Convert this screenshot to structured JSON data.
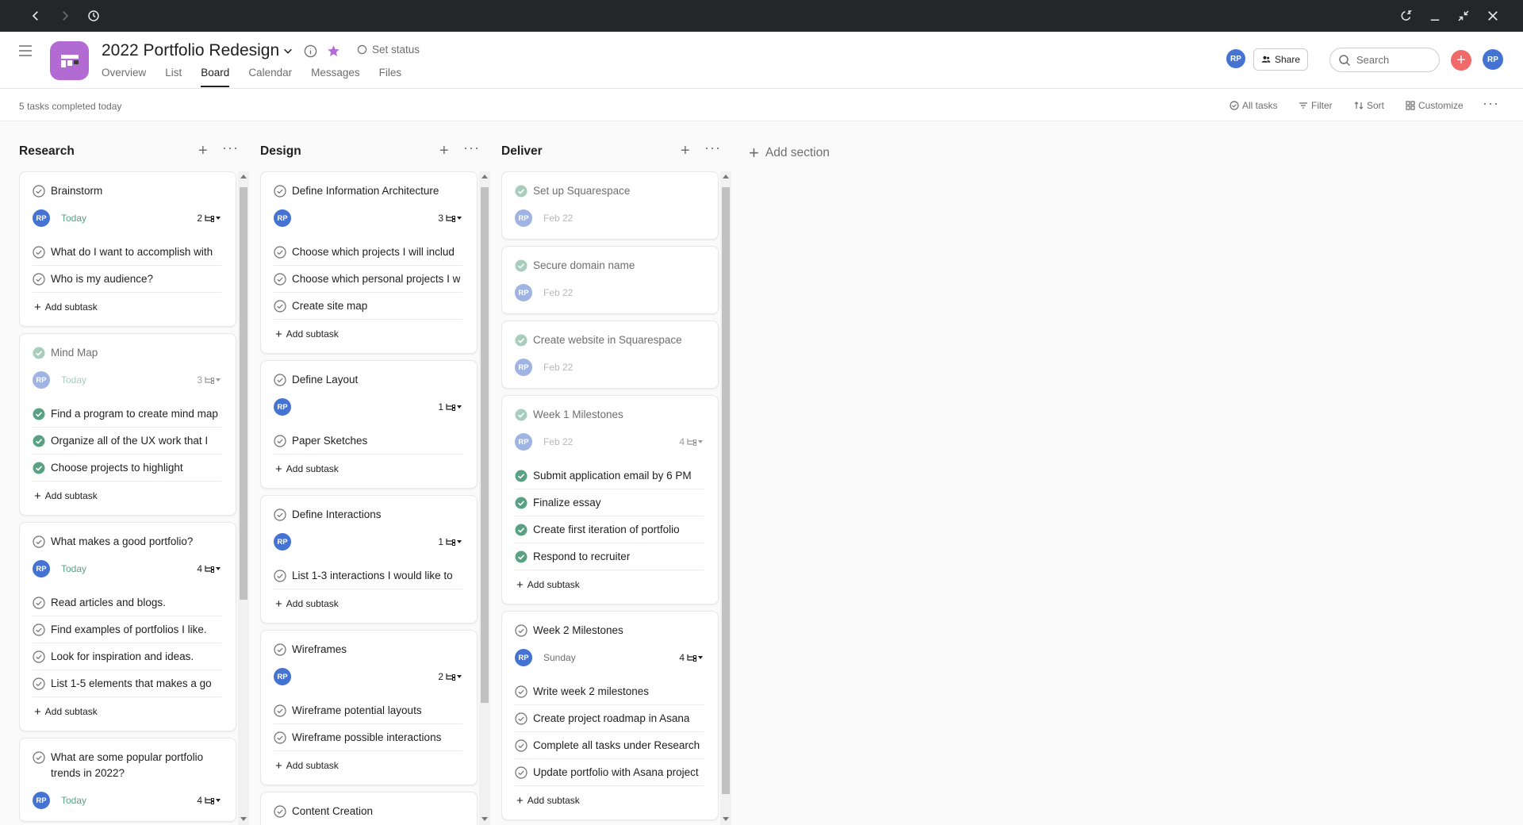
{
  "header": {
    "project_title": "2022 Portfolio Redesign",
    "set_status": "Set status",
    "tabs": [
      "Overview",
      "List",
      "Board",
      "Calendar",
      "Messages",
      "Files"
    ],
    "active_tab": "Board",
    "avatar_initials": "RP",
    "share_label": "Share",
    "search_placeholder": "Search"
  },
  "toolbar": {
    "tasks_completed": "5 tasks completed today",
    "all_tasks": "All tasks",
    "filter": "Filter",
    "sort": "Sort",
    "customize": "Customize"
  },
  "board": {
    "add_section": "Add section",
    "add_subtask_label": "Add subtask",
    "columns": [
      {
        "title": "Research",
        "cards": [
          {
            "title": "Brainstorm",
            "date": "Today",
            "date_style": "today",
            "subtask_count": "2",
            "completed": false,
            "subtasks": [
              {
                "label": "What do I want to accomplish with",
                "done": false
              },
              {
                "label": "Who is my audience?",
                "done": false
              }
            ]
          },
          {
            "title": "Mind Map",
            "date": "Today",
            "date_style": "today",
            "subtask_count": "3",
            "completed": true,
            "subtasks": [
              {
                "label": "Find a program to create mind map",
                "done": true
              },
              {
                "label": "Organize all of the UX work that I",
                "done": true
              },
              {
                "label": "Choose projects to highlight",
                "done": true
              }
            ]
          },
          {
            "title": "What makes a good portfolio?",
            "date": "Today",
            "date_style": "today",
            "subtask_count": "4",
            "completed": false,
            "subtasks": [
              {
                "label": "Read articles and blogs.",
                "done": false
              },
              {
                "label": "Find examples of portfolios I like.",
                "done": false
              },
              {
                "label": "Look for inspiration and ideas.",
                "done": false
              },
              {
                "label": "List 1-5 elements that makes a go",
                "done": false
              }
            ]
          },
          {
            "title": "What are some popular portfolio trends in 2022?",
            "date": "Today",
            "date_style": "today",
            "subtask_count": "4",
            "completed": false,
            "subtasks": []
          }
        ]
      },
      {
        "title": "Design",
        "cards": [
          {
            "title": "Define Information Architecture",
            "date": "",
            "date_style": "none",
            "subtask_count": "3",
            "completed": false,
            "subtasks": [
              {
                "label": "Choose which projects I will includ",
                "done": false
              },
              {
                "label": "Choose which personal projects I w",
                "done": false
              },
              {
                "label": "Create site map",
                "done": false
              }
            ]
          },
          {
            "title": "Define Layout",
            "date": "",
            "date_style": "none",
            "subtask_count": "1",
            "completed": false,
            "subtasks": [
              {
                "label": "Paper Sketches",
                "done": false
              }
            ]
          },
          {
            "title": "Define Interactions",
            "date": "",
            "date_style": "none",
            "subtask_count": "1",
            "completed": false,
            "subtasks": [
              {
                "label": "List 1-3 interactions I would like to",
                "done": false
              }
            ]
          },
          {
            "title": "Wireframes",
            "date": "",
            "date_style": "none",
            "subtask_count": "2",
            "completed": false,
            "subtasks": [
              {
                "label": "Wireframe potential layouts",
                "done": false
              },
              {
                "label": "Wireframe possible interactions",
                "done": false
              }
            ]
          },
          {
            "title": "Content Creation",
            "date": "",
            "date_style": "none",
            "subtask_count": "",
            "completed": false,
            "subtasks": []
          }
        ]
      },
      {
        "title": "Deliver",
        "cards": [
          {
            "title": "Set up Squarespace",
            "date": "Feb 22",
            "date_style": "gray",
            "subtask_count": "",
            "completed": true,
            "subtasks": []
          },
          {
            "title": "Secure domain name",
            "date": "Feb 22",
            "date_style": "gray",
            "subtask_count": "",
            "completed": true,
            "subtasks": []
          },
          {
            "title": "Create website in Squarespace",
            "date": "Feb 22",
            "date_style": "gray",
            "subtask_count": "",
            "completed": true,
            "subtasks": []
          },
          {
            "title": "Week 1 Milestones",
            "date": "Feb 22",
            "date_style": "gray",
            "subtask_count": "4",
            "completed": true,
            "subtasks": [
              {
                "label": "Submit application email by 6 PM",
                "done": true
              },
              {
                "label": "Finalize essay",
                "done": true
              },
              {
                "label": "Create first iteration of portfolio",
                "done": true
              },
              {
                "label": "Respond to recruiter",
                "done": true
              }
            ]
          },
          {
            "title": "Week 2 Milestones",
            "date": "Sunday",
            "date_style": "gray",
            "subtask_count": "4",
            "completed": false,
            "subtasks": [
              {
                "label": "Write week 2 milestones",
                "done": false
              },
              {
                "label": "Create project roadmap in Asana",
                "done": false
              },
              {
                "label": "Complete all tasks under Research",
                "done": false
              },
              {
                "label": "Update portfolio with Asana project",
                "done": false
              }
            ]
          }
        ]
      }
    ]
  },
  "colors": {
    "accent_purple": "#b36bd4",
    "avatar_blue": "#4573d2",
    "done_green": "#58a182",
    "add_red": "#f06a6a",
    "titlebar": "#252628"
  }
}
